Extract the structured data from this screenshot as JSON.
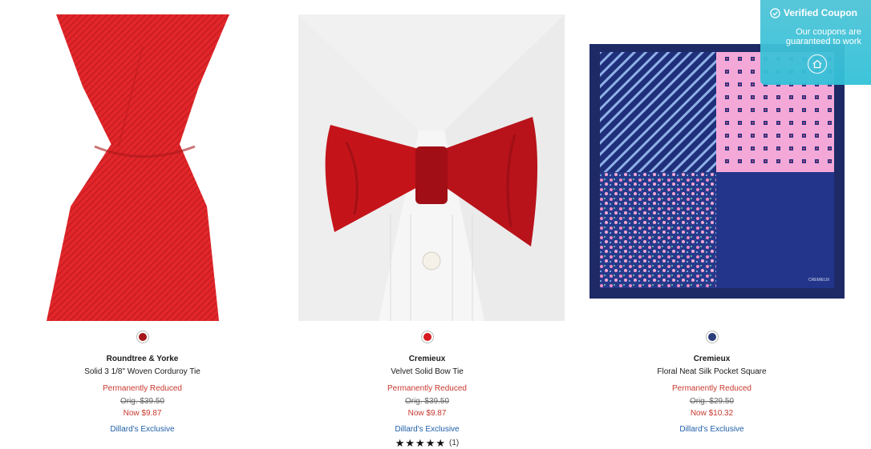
{
  "coupon_widget": {
    "title": "Verified Coupon",
    "subtitle": "Our coupons are guaranteed to work",
    "check_icon": "check-circle-icon",
    "home_icon": "home-icon"
  },
  "products": [
    {
      "brand": "Roundtree & Yorke",
      "name": "Solid 3 1/8\" Woven Corduroy Tie",
      "status": "Permanently Reduced",
      "orig_price": "Orig. $39.50",
      "now_price": "Now $9.87",
      "exclusive": "Dillard's Exclusive",
      "swatch_color": "#a4161a",
      "image": "red-woven-tie"
    },
    {
      "brand": "Cremieux",
      "name": "Velvet Solid Bow Tie",
      "status": "Permanently Reduced",
      "orig_price": "Orig. $39.50",
      "now_price": "Now $9.87",
      "exclusive": "Dillard's Exclusive",
      "swatch_color": "#d71920",
      "image": "red-velvet-bow-tie",
      "rating_stars": "★★★★★",
      "rating_count": "(1)"
    },
    {
      "brand": "Cremieux",
      "name": "Floral Neat Silk Pocket Square",
      "status": "Permanently Reduced",
      "orig_price": "Orig. $29.50",
      "now_price": "Now $10.32",
      "exclusive": "Dillard's Exclusive",
      "swatch_color": "#2b3d7a",
      "image": "navy-pink-pocket-square",
      "image_text": "CREMIEUX"
    }
  ]
}
